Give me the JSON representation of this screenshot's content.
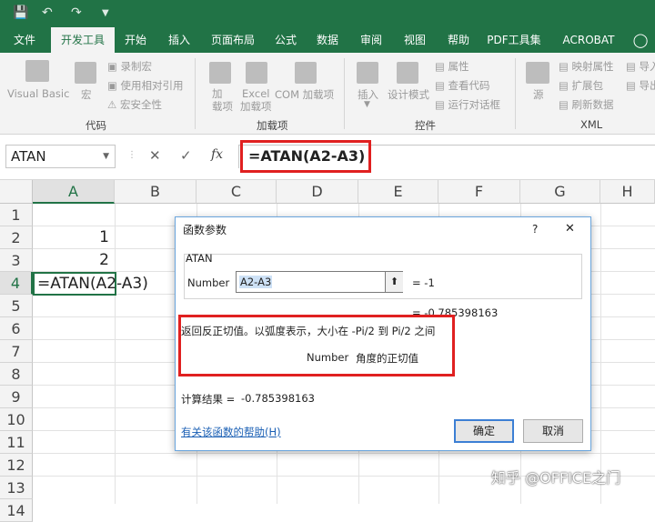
{
  "qat": {
    "save_icon": "save-icon",
    "undo_icon": "undo-icon",
    "redo_icon": "redo-icon"
  },
  "tabs": [
    {
      "label": "文件",
      "active": false
    },
    {
      "label": "开发工具",
      "active": true
    },
    {
      "label": "开始",
      "active": false
    },
    {
      "label": "插入",
      "active": false
    },
    {
      "label": "页面布局",
      "active": false
    },
    {
      "label": "公式",
      "active": false
    },
    {
      "label": "数据",
      "active": false
    },
    {
      "label": "审阅",
      "active": false
    },
    {
      "label": "视图",
      "active": false
    },
    {
      "label": "帮助",
      "active": false
    },
    {
      "label": "PDF工具集",
      "active": false
    },
    {
      "label": "ACROBAT",
      "active": false
    }
  ],
  "tell_me_icon": "lightbulb-icon",
  "ribbon": {
    "code": {
      "label": "代码",
      "visual_basic": "Visual Basic",
      "macro": "宏",
      "record_macro": "录制宏",
      "relative_ref": "使用相对引用",
      "macro_security": "宏安全性"
    },
    "addins": {
      "label": "加载项",
      "addin": "加\n载项",
      "excel_addin": "Excel\n加载项",
      "com_addin": "COM 加载项"
    },
    "controls": {
      "label": "控件",
      "insert": "插入",
      "design_mode": "设计模式",
      "properties": "属性",
      "view_code": "查看代码",
      "run_dialog": "运行对话框"
    },
    "xml": {
      "label": "XML",
      "source": "源",
      "map_props": "映射属性",
      "expansion": "扩展包",
      "refresh": "刷新数据",
      "import": "导入",
      "export": "导出"
    }
  },
  "formula_bar": {
    "name_box": "ATAN",
    "cancel": "✕",
    "enter": "✓",
    "fx": "fx",
    "formula": "=ATAN(A2-A3)"
  },
  "grid": {
    "columns": [
      "A",
      "B",
      "C",
      "D",
      "E",
      "F",
      "G",
      "H"
    ],
    "rows": [
      "1",
      "2",
      "3",
      "4",
      "5",
      "6",
      "7",
      "8",
      "9",
      "10",
      "11",
      "12",
      "13",
      "14"
    ],
    "cells": {
      "A2": "1",
      "A3": "2",
      "A4": "=ATAN(A2-A3)"
    }
  },
  "dialog": {
    "title": "函数参数",
    "help_q": "?",
    "close": "✕",
    "function_name": "ATAN",
    "arg_label": "Number",
    "arg_value": "A2-A3",
    "arg_result": "=  -1",
    "eq_result": "=  -0.785398163",
    "description": "返回反正切值。以弧度表示，大小在 -Pi/2 到 Pi/2 之间",
    "arg_desc_name": "Number",
    "arg_desc_text": "角度的正切值",
    "calc_result_label": "计算结果 =",
    "calc_result_value": "-0.785398163",
    "help_link": "有关该函数的帮助(H)",
    "ok": "确定",
    "cancel": "取消"
  },
  "watermark": "知乎 @OFFICE之门"
}
